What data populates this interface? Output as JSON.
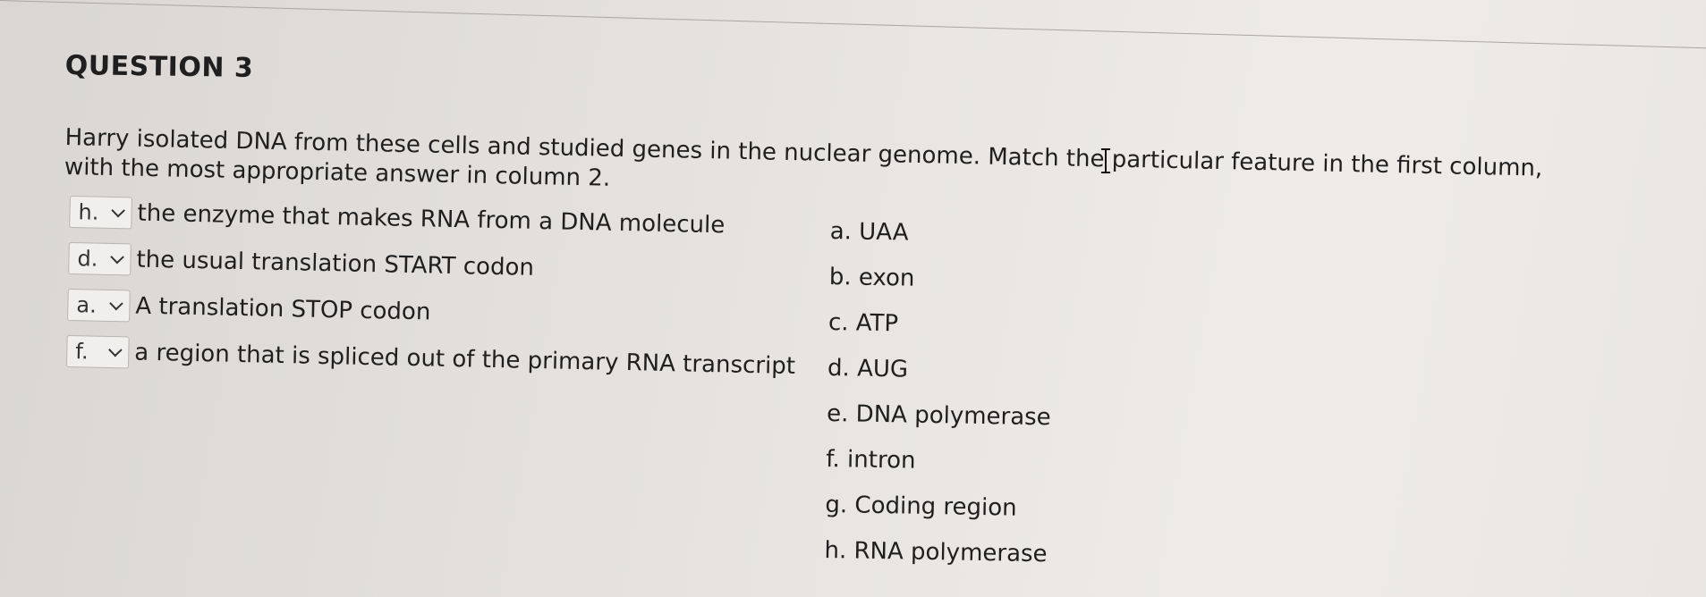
{
  "question": {
    "title": "QUESTION 3",
    "prompt": "Harry isolated DNA from these cells and studied genes in the nuclear genome. Match the particular feature in the first column, with the most appropriate answer in column 2."
  },
  "matches": [
    {
      "selected": "h.",
      "text": "the enzyme that makes RNA from a DNA molecule"
    },
    {
      "selected": "d.",
      "text": "the usual translation START codon"
    },
    {
      "selected": "a.",
      "text": "A translation STOP codon"
    },
    {
      "selected": "f.",
      "text": "a region that is spliced out of the primary RNA transcript"
    }
  ],
  "answers": [
    "a. UAA",
    "b. exon",
    "c. ATP",
    "d. AUG",
    "e. DNA polymerase",
    "f.  intron",
    "g. Coding region",
    "h. RNA polymerase"
  ]
}
